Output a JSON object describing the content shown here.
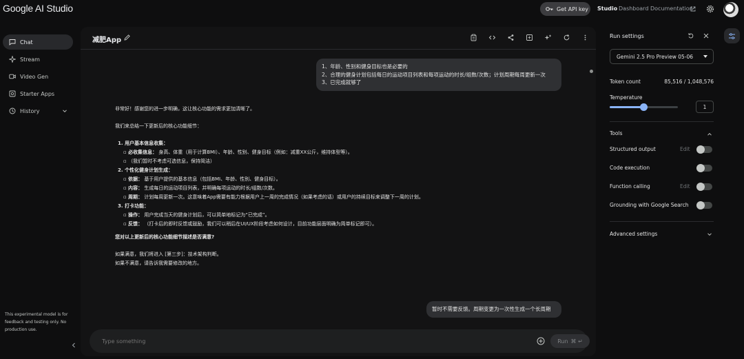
{
  "app": {
    "title": "Google AI Studio"
  },
  "topbar": {
    "api_key_label": "Get API key",
    "nav": [
      "Studio",
      "Dashboard",
      "Documentation"
    ]
  },
  "sidebar": {
    "items": [
      {
        "label": "Chat",
        "icon": "chat-icon",
        "active": true
      },
      {
        "label": "Stream",
        "icon": "stream-icon",
        "active": false
      },
      {
        "label": "Video Gen",
        "icon": "video-icon",
        "active": false
      },
      {
        "label": "Starter Apps",
        "icon": "apps-icon",
        "active": false
      },
      {
        "label": "History",
        "icon": "history-icon",
        "active": false
      }
    ],
    "note": "This experimental model is for feedback and testing only. No production use."
  },
  "chat": {
    "title": "减肥App",
    "messages": {
      "user1": [
        "1、年龄、性别和健身目标也是必要的",
        "2、合理的健身计划包括每日的运动项目列表和每项运动的时长/组数/次数；计划周期每周更新一次",
        "3、已完成就够了"
      ],
      "model": {
        "intro": "非常好！感谢您的进一步明确，这让核心功能的需求更加清晰了。",
        "summary": "我们来总结一下更新后的核心功能细节：",
        "s1_title": "1. 用户基本信息收集：",
        "s1_a_label": "必收集信息：",
        "s1_a_text": "身高、体重（用于计算BMI）、年龄、性别、健身目标（例如：减重XX公斤，维持体型等）。",
        "s1_b_text": "（我们暂时不考虑可选信息，保持简洁）",
        "s2_title": "2. 个性化健身计划生成：",
        "s2_a_label": "依据：",
        "s2_a_text": "基于用户提供的基本信息（包括BMI、年龄、性别、健身目标）。",
        "s2_b_label": "内容：",
        "s2_b_text": "生成每日的运动项目列表，并明确每项运动的时长/组数/次数。",
        "s2_c_label": "周期：",
        "s2_c_text": "计划每周更新一次。这意味着App需要有能力根据用户上一周的完成情况（如果考虑的话）或用户的持续目标来调整下一周的计划。",
        "s3_title": "3. 打卡功能：",
        "s3_a_label": "操作：",
        "s3_a_text": "用户完成当天的健身计划后，可以简单地标记为“已完成”。",
        "s3_b_label": "反馈：",
        "s3_b_text": "（打卡后的即时反馈或鼓励，我们可以稍后在UI/UX阶段考虑如何设计，目前功能层面明确为简单标记即可）。",
        "question": "您对以上更新后的核心功能细节描述是否满意?",
        "if_yes": "如果满意，我们将进入 [第三步]：技术架构判断。",
        "if_no": "如果不满意，请告诉我需要修改的地方。"
      },
      "user2": "暂时不需要反馈。周期变更为一次性生成一个长周期"
    },
    "input": {
      "placeholder": "Type something",
      "run_label": "Run",
      "run_shortcut": "⌘ ↵"
    }
  },
  "run_settings": {
    "title": "Run settings",
    "model": "Gemini 2.5 Pro Preview 05-06",
    "token_count_label": "Token count",
    "token_count_value": "85,516 / 1,048,576",
    "temperature_label": "Temperature",
    "temperature_value": "1",
    "temperature_fraction": 0.5,
    "tools_label": "Tools",
    "tools": [
      {
        "name": "Structured output",
        "edit": "Edit",
        "enabled": false
      },
      {
        "name": "Code execution",
        "edit": "",
        "enabled": false
      },
      {
        "name": "Function calling",
        "edit": "Edit",
        "enabled": false
      },
      {
        "name": "Grounding with Google Search",
        "edit": "",
        "enabled": false
      }
    ],
    "advanced_label": "Advanced settings"
  },
  "colors": {
    "background": "#0e0e0f",
    "panel": "#131314",
    "bubble": "#2f3033",
    "accent": "#8ab4f8"
  }
}
